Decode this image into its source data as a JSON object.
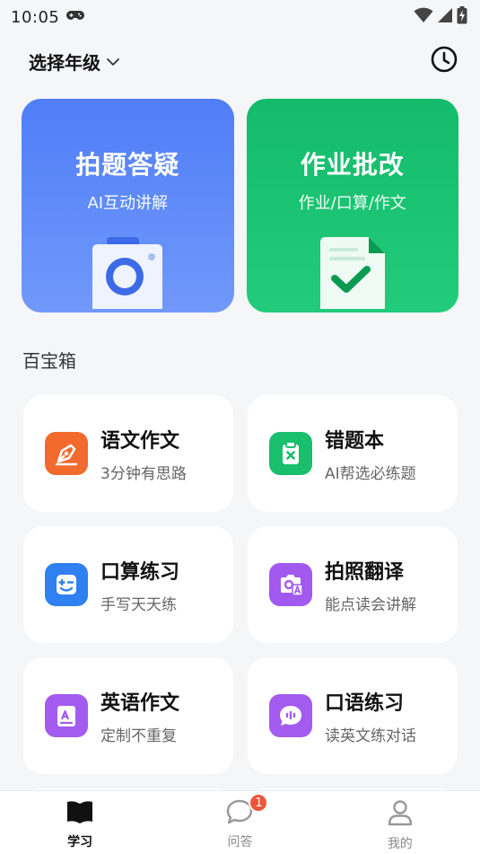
{
  "status_bar": {
    "time": "10:05",
    "icons": [
      "gamepad-icon",
      "wifi-icon",
      "signal-icon",
      "battery-charging-icon"
    ]
  },
  "header": {
    "grade_label": "选择年级",
    "history_icon": "clock-icon"
  },
  "hero": [
    {
      "title": "拍题答疑",
      "subtitle": "AI互动讲解",
      "color": "#4f7ef7",
      "icon": "camera-icon"
    },
    {
      "title": "作业批改",
      "subtitle": "作业/口算/作文",
      "color": "#13bb6a",
      "icon": "document-check-icon"
    }
  ],
  "toolbox": {
    "title": "百宝箱",
    "items": [
      {
        "name": "语文作文",
        "desc": "3分钟有思路",
        "color": "#f26a2e",
        "icon": "pen-nib-icon"
      },
      {
        "name": "错题本",
        "desc": "AI帮选必练题",
        "color": "#19bf6c",
        "icon": "clipboard-x-icon"
      },
      {
        "name": "口算练习",
        "desc": "手写天天练",
        "color": "#2f80f0",
        "icon": "calculator-smile-icon"
      },
      {
        "name": "拍照翻译",
        "desc": "能点读会讲解",
        "color": "#a259f0",
        "icon": "camera-translate-icon"
      },
      {
        "name": "英语作文",
        "desc": "定制不重复",
        "color": "#a35bf0",
        "icon": "english-doc-icon"
      },
      {
        "name": "口语练习",
        "desc": "读英文练对话",
        "color": "#a35bf0",
        "icon": "speech-bubble-icon"
      }
    ]
  },
  "tabs": [
    {
      "label": "学习",
      "icon": "book-icon",
      "active": true
    },
    {
      "label": "问答",
      "icon": "chat-bubble-icon",
      "badge": "1"
    },
    {
      "label": "我的",
      "icon": "user-icon"
    }
  ]
}
